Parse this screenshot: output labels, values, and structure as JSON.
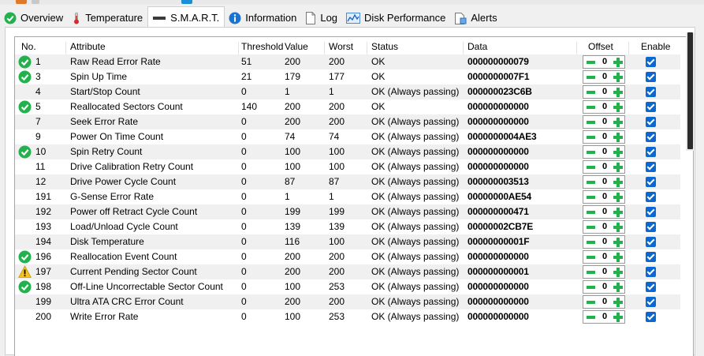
{
  "colors": {
    "ok_green": "#22b14c",
    "warn_yellow": "#f6c21c",
    "checkbox_blue": "#0a68d0",
    "row_shade": "#f0f0f0"
  },
  "tabs": [
    {
      "label": "Overview",
      "icon": "check-circle-icon",
      "active": false
    },
    {
      "label": "Temperature",
      "icon": "thermometer-icon",
      "active": false
    },
    {
      "label": "S.M.A.R.T.",
      "icon": "disk-bar-icon",
      "active": true
    },
    {
      "label": "Information",
      "icon": "info-icon",
      "active": false
    },
    {
      "label": "Log",
      "icon": "document-icon",
      "active": false
    },
    {
      "label": "Disk Performance",
      "icon": "performance-chart-icon",
      "active": false
    },
    {
      "label": "Alerts",
      "icon": "alerts-doc-icon",
      "active": false
    }
  ],
  "table": {
    "headers": {
      "no": "No.",
      "attribute": "Attribute",
      "threshold": "Threshold",
      "value": "Value",
      "worst": "Worst",
      "status": "Status",
      "data": "Data",
      "offset": "Offset",
      "enable": "Enable"
    },
    "rows": [
      {
        "icon": "ok",
        "no": "1",
        "attribute": "Raw Read Error Rate",
        "threshold": "51",
        "value": "200",
        "worst": "200",
        "status": "OK",
        "data": "000000000079",
        "offset": "0",
        "enabled": true
      },
      {
        "icon": "ok",
        "no": "3",
        "attribute": "Spin Up Time",
        "threshold": "21",
        "value": "179",
        "worst": "177",
        "status": "OK",
        "data": "0000000007F1",
        "offset": "0",
        "enabled": true
      },
      {
        "icon": "",
        "no": "4",
        "attribute": "Start/Stop Count",
        "threshold": "0",
        "value": "1",
        "worst": "1",
        "status": "OK (Always passing)",
        "data": "000000023C6B",
        "offset": "0",
        "enabled": true
      },
      {
        "icon": "ok",
        "no": "5",
        "attribute": "Reallocated Sectors Count",
        "threshold": "140",
        "value": "200",
        "worst": "200",
        "status": "OK",
        "data": "000000000000",
        "offset": "0",
        "enabled": true
      },
      {
        "icon": "",
        "no": "7",
        "attribute": "Seek Error Rate",
        "threshold": "0",
        "value": "200",
        "worst": "200",
        "status": "OK (Always passing)",
        "data": "000000000000",
        "offset": "0",
        "enabled": true
      },
      {
        "icon": "",
        "no": "9",
        "attribute": "Power On Time Count",
        "threshold": "0",
        "value": "74",
        "worst": "74",
        "status": "OK (Always passing)",
        "data": "0000000004AE3",
        "offset": "0",
        "enabled": true
      },
      {
        "icon": "ok",
        "no": "10",
        "attribute": "Spin Retry Count",
        "threshold": "0",
        "value": "100",
        "worst": "100",
        "status": "OK (Always passing)",
        "data": "000000000000",
        "offset": "0",
        "enabled": true
      },
      {
        "icon": "",
        "no": "11",
        "attribute": "Drive Calibration Retry Count",
        "threshold": "0",
        "value": "100",
        "worst": "100",
        "status": "OK (Always passing)",
        "data": "000000000000",
        "offset": "0",
        "enabled": true
      },
      {
        "icon": "",
        "no": "12",
        "attribute": "Drive Power Cycle Count",
        "threshold": "0",
        "value": "87",
        "worst": "87",
        "status": "OK (Always passing)",
        "data": "000000003513",
        "offset": "0",
        "enabled": true
      },
      {
        "icon": "",
        "no": "191",
        "attribute": "G-Sense Error Rate",
        "threshold": "0",
        "value": "1",
        "worst": "1",
        "status": "OK (Always passing)",
        "data": "00000000AE54",
        "offset": "0",
        "enabled": true
      },
      {
        "icon": "",
        "no": "192",
        "attribute": "Power off Retract Cycle Count",
        "threshold": "0",
        "value": "199",
        "worst": "199",
        "status": "OK (Always passing)",
        "data": "000000000471",
        "offset": "0",
        "enabled": true
      },
      {
        "icon": "",
        "no": "193",
        "attribute": "Load/Unload Cycle Count",
        "threshold": "0",
        "value": "139",
        "worst": "139",
        "status": "OK (Always passing)",
        "data": "00000002CB7E",
        "offset": "0",
        "enabled": true
      },
      {
        "icon": "",
        "no": "194",
        "attribute": "Disk Temperature",
        "threshold": "0",
        "value": "116",
        "worst": "100",
        "status": "OK (Always passing)",
        "data": "00000000001F",
        "offset": "0",
        "enabled": true
      },
      {
        "icon": "ok",
        "no": "196",
        "attribute": "Reallocation Event Count",
        "threshold": "0",
        "value": "200",
        "worst": "200",
        "status": "OK (Always passing)",
        "data": "000000000000",
        "offset": "0",
        "enabled": true
      },
      {
        "icon": "warn",
        "no": "197",
        "attribute": "Current Pending Sector Count",
        "threshold": "0",
        "value": "200",
        "worst": "200",
        "status": "OK (Always passing)",
        "data": "000000000001",
        "offset": "0",
        "enabled": true
      },
      {
        "icon": "ok",
        "no": "198",
        "attribute": "Off-Line Uncorrectable Sector Count",
        "threshold": "0",
        "value": "100",
        "worst": "253",
        "status": "OK (Always passing)",
        "data": "000000000000",
        "offset": "0",
        "enabled": true
      },
      {
        "icon": "",
        "no": "199",
        "attribute": "Ultra ATA CRC Error Count",
        "threshold": "0",
        "value": "200",
        "worst": "200",
        "status": "OK (Always passing)",
        "data": "000000000000",
        "offset": "0",
        "enabled": true
      },
      {
        "icon": "",
        "no": "200",
        "attribute": "Write Error Rate",
        "threshold": "0",
        "value": "100",
        "worst": "253",
        "status": "OK (Always passing)",
        "data": "000000000000",
        "offset": "0",
        "enabled": true
      }
    ]
  }
}
